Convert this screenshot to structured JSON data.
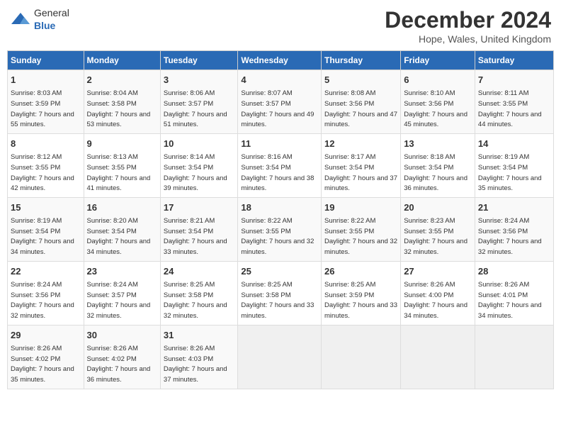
{
  "header": {
    "logo_general": "General",
    "logo_blue": "Blue",
    "main_title": "December 2024",
    "sub_title": "Hope, Wales, United Kingdom"
  },
  "days_of_week": [
    "Sunday",
    "Monday",
    "Tuesday",
    "Wednesday",
    "Thursday",
    "Friday",
    "Saturday"
  ],
  "weeks": [
    [
      {
        "day": "1",
        "rise": "8:03 AM",
        "set": "3:59 PM",
        "daylight": "7 hours and 55 minutes."
      },
      {
        "day": "2",
        "rise": "8:04 AM",
        "set": "3:58 PM",
        "daylight": "7 hours and 53 minutes."
      },
      {
        "day": "3",
        "rise": "8:06 AM",
        "set": "3:57 PM",
        "daylight": "7 hours and 51 minutes."
      },
      {
        "day": "4",
        "rise": "8:07 AM",
        "set": "3:57 PM",
        "daylight": "7 hours and 49 minutes."
      },
      {
        "day": "5",
        "rise": "8:08 AM",
        "set": "3:56 PM",
        "daylight": "7 hours and 47 minutes."
      },
      {
        "day": "6",
        "rise": "8:10 AM",
        "set": "3:56 PM",
        "daylight": "7 hours and 45 minutes."
      },
      {
        "day": "7",
        "rise": "8:11 AM",
        "set": "3:55 PM",
        "daylight": "7 hours and 44 minutes."
      }
    ],
    [
      {
        "day": "8",
        "rise": "8:12 AM",
        "set": "3:55 PM",
        "daylight": "7 hours and 42 minutes."
      },
      {
        "day": "9",
        "rise": "8:13 AM",
        "set": "3:55 PM",
        "daylight": "7 hours and 41 minutes."
      },
      {
        "day": "10",
        "rise": "8:14 AM",
        "set": "3:54 PM",
        "daylight": "7 hours and 39 minutes."
      },
      {
        "day": "11",
        "rise": "8:16 AM",
        "set": "3:54 PM",
        "daylight": "7 hours and 38 minutes."
      },
      {
        "day": "12",
        "rise": "8:17 AM",
        "set": "3:54 PM",
        "daylight": "7 hours and 37 minutes."
      },
      {
        "day": "13",
        "rise": "8:18 AM",
        "set": "3:54 PM",
        "daylight": "7 hours and 36 minutes."
      },
      {
        "day": "14",
        "rise": "8:19 AM",
        "set": "3:54 PM",
        "daylight": "7 hours and 35 minutes."
      }
    ],
    [
      {
        "day": "15",
        "rise": "8:19 AM",
        "set": "3:54 PM",
        "daylight": "7 hours and 34 minutes."
      },
      {
        "day": "16",
        "rise": "8:20 AM",
        "set": "3:54 PM",
        "daylight": "7 hours and 34 minutes."
      },
      {
        "day": "17",
        "rise": "8:21 AM",
        "set": "3:54 PM",
        "daylight": "7 hours and 33 minutes."
      },
      {
        "day": "18",
        "rise": "8:22 AM",
        "set": "3:55 PM",
        "daylight": "7 hours and 32 minutes."
      },
      {
        "day": "19",
        "rise": "8:22 AM",
        "set": "3:55 PM",
        "daylight": "7 hours and 32 minutes."
      },
      {
        "day": "20",
        "rise": "8:23 AM",
        "set": "3:55 PM",
        "daylight": "7 hours and 32 minutes."
      },
      {
        "day": "21",
        "rise": "8:24 AM",
        "set": "3:56 PM",
        "daylight": "7 hours and 32 minutes."
      }
    ],
    [
      {
        "day": "22",
        "rise": "8:24 AM",
        "set": "3:56 PM",
        "daylight": "7 hours and 32 minutes."
      },
      {
        "day": "23",
        "rise": "8:24 AM",
        "set": "3:57 PM",
        "daylight": "7 hours and 32 minutes."
      },
      {
        "day": "24",
        "rise": "8:25 AM",
        "set": "3:58 PM",
        "daylight": "7 hours and 32 minutes."
      },
      {
        "day": "25",
        "rise": "8:25 AM",
        "set": "3:58 PM",
        "daylight": "7 hours and 33 minutes."
      },
      {
        "day": "26",
        "rise": "8:25 AM",
        "set": "3:59 PM",
        "daylight": "7 hours and 33 minutes."
      },
      {
        "day": "27",
        "rise": "8:26 AM",
        "set": "4:00 PM",
        "daylight": "7 hours and 34 minutes."
      },
      {
        "day": "28",
        "rise": "8:26 AM",
        "set": "4:01 PM",
        "daylight": "7 hours and 34 minutes."
      }
    ],
    [
      {
        "day": "29",
        "rise": "8:26 AM",
        "set": "4:02 PM",
        "daylight": "7 hours and 35 minutes."
      },
      {
        "day": "30",
        "rise": "8:26 AM",
        "set": "4:02 PM",
        "daylight": "7 hours and 36 minutes."
      },
      {
        "day": "31",
        "rise": "8:26 AM",
        "set": "4:03 PM",
        "daylight": "7 hours and 37 minutes."
      },
      null,
      null,
      null,
      null
    ]
  ],
  "labels": {
    "sunrise": "Sunrise:",
    "sunset": "Sunset:",
    "daylight": "Daylight:"
  }
}
